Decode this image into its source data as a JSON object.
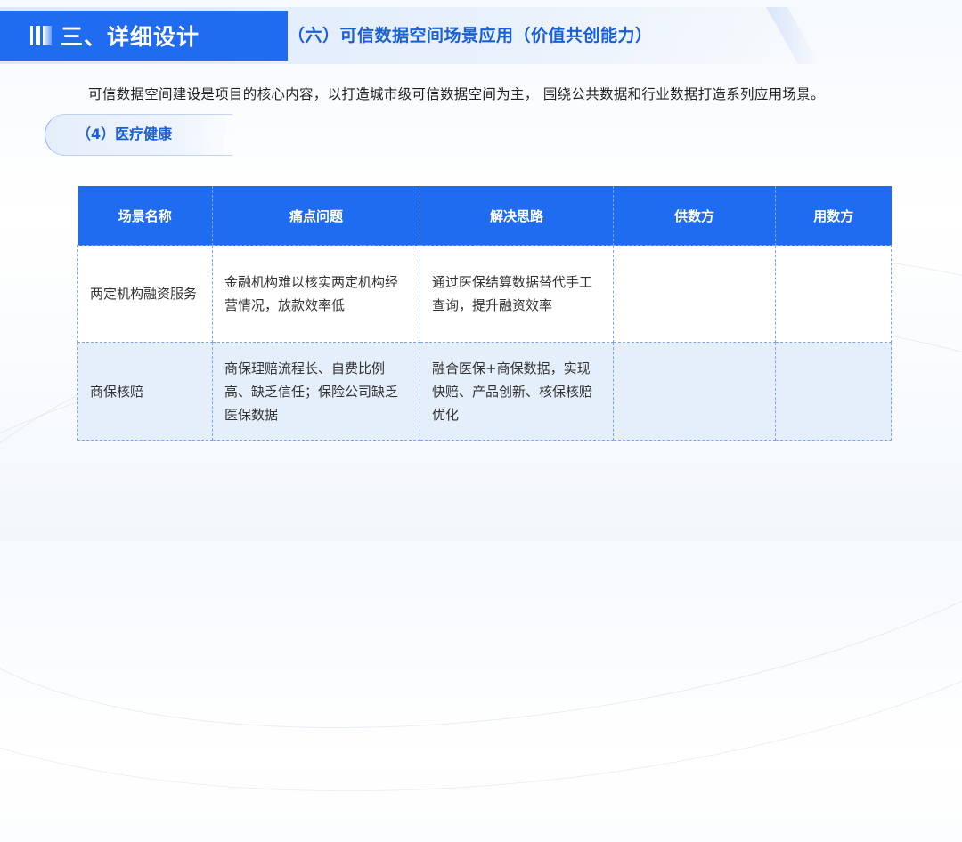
{
  "header": {
    "section_title": "三、详细设计",
    "sub_title": "（六）可信数据空间场景应用（价值共创能力）"
  },
  "intro": "可信数据空间建设是项目的核心内容，以打造城市级可信数据空间为主， 围绕公共数据和行业数据打造系列应用场景。",
  "pill_label": "（4）医疗健康",
  "table": {
    "headers": [
      "场景名称",
      "痛点问题",
      "解决思路",
      "供数方",
      "用数方"
    ],
    "rows": [
      {
        "name": "两定机构融资服务",
        "pain": "金融机构难以核实两定机构经营情况，放款效率低",
        "solution": "通过医保结算数据替代手工查询，提升融资效率",
        "supplier": "",
        "user": ""
      },
      {
        "name": "商保核赔",
        "pain": "商保理赔流程长、自费比例高、缺乏信任；保险公司缺乏医保数据",
        "solution": "融合医保+商保数据，实现快赔、产品创新、核保核赔优化",
        "supplier": "",
        "user": ""
      }
    ]
  }
}
